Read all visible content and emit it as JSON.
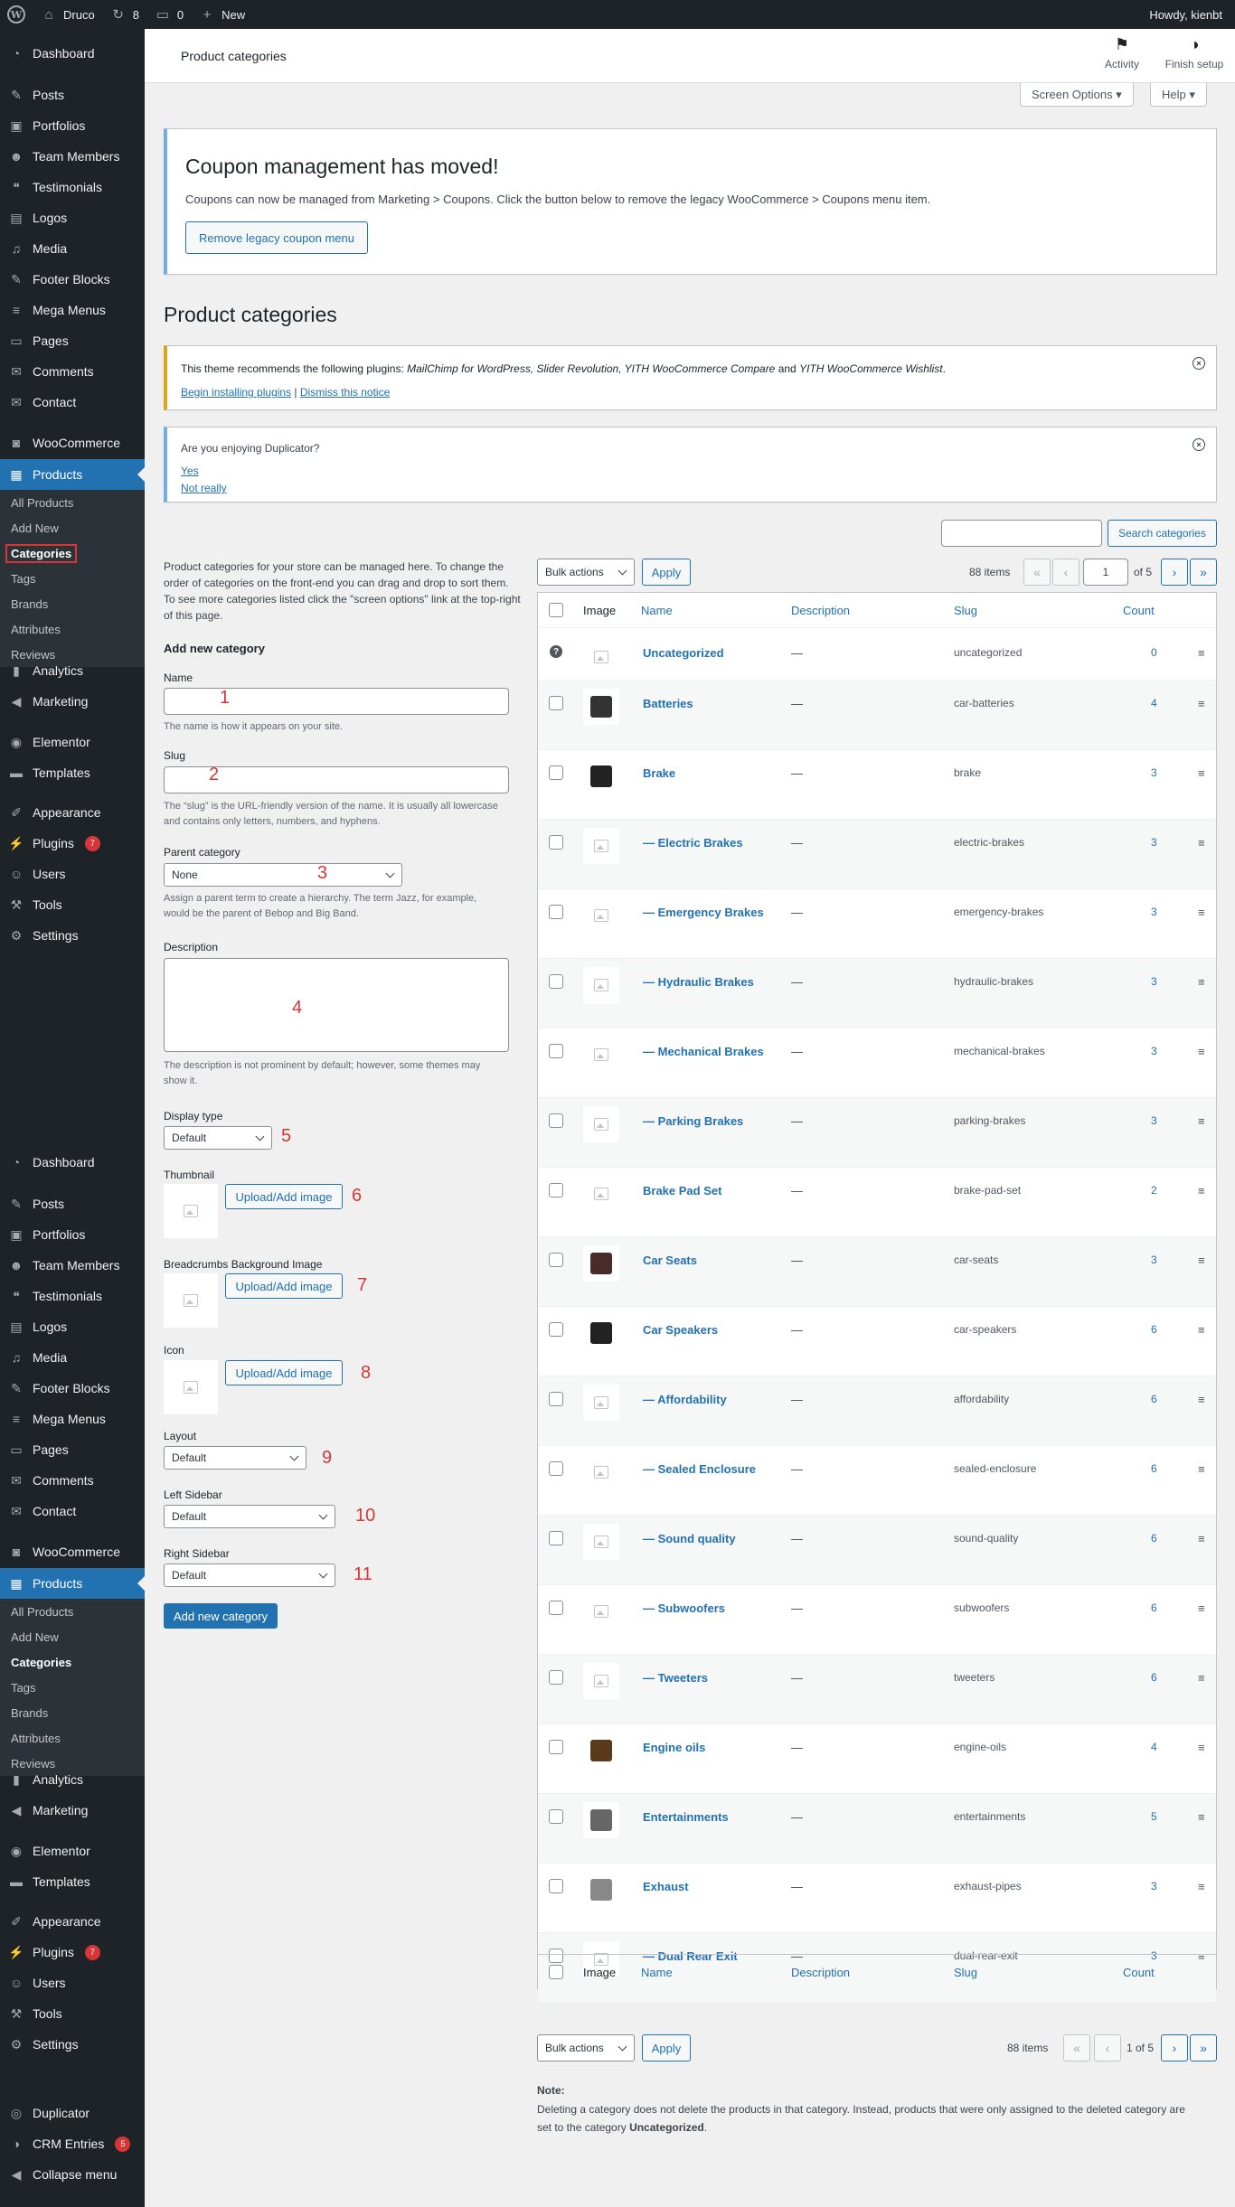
{
  "adminbar": {
    "site_name": "Druco",
    "updates_count": "8",
    "comments_count": "0",
    "new_label": "New",
    "howdy": "Howdy, kienbt"
  },
  "sidebar_top": [
    {
      "label": "Dashboard",
      "icon": "dashboard-icon",
      "glyph": "◔"
    },
    {
      "label": "Posts",
      "icon": "pin-icon",
      "glyph": "✎"
    },
    {
      "label": "Portfolios",
      "icon": "portfolio-icon",
      "glyph": "▣"
    },
    {
      "label": "Team Members",
      "icon": "people-icon",
      "glyph": "☻"
    },
    {
      "label": "Testimonials",
      "icon": "testimonial-icon",
      "glyph": "❝"
    },
    {
      "label": "Logos",
      "icon": "logos-icon",
      "glyph": "▤"
    },
    {
      "label": "Media",
      "icon": "media-icon",
      "glyph": "♫"
    },
    {
      "label": "Footer Blocks",
      "icon": "pin-icon",
      "glyph": "✎"
    },
    {
      "label": "Mega Menus",
      "icon": "menu-icon",
      "glyph": "≡"
    },
    {
      "label": "Pages",
      "icon": "page-icon",
      "glyph": "▭"
    },
    {
      "label": "Comments",
      "icon": "comment-icon",
      "glyph": "✉"
    },
    {
      "label": "Contact",
      "icon": "mail-icon",
      "glyph": "✉"
    },
    {
      "label": "WooCommerce",
      "icon": "woo-icon",
      "glyph": "◙"
    },
    {
      "label": "Products",
      "icon": "products-icon",
      "glyph": "▦"
    }
  ],
  "submenu": [
    "All Products",
    "Add New",
    "Categories",
    "Tags",
    "Brands",
    "Attributes",
    "Reviews"
  ],
  "sidebar_mid": [
    {
      "label": "Analytics",
      "icon": "chart-icon",
      "glyph": "▮"
    },
    {
      "label": "Marketing",
      "icon": "megaphone-icon",
      "glyph": "◀"
    },
    {
      "label": "Elementor",
      "icon": "elementor-icon",
      "glyph": "◉"
    },
    {
      "label": "Templates",
      "icon": "folder-icon",
      "glyph": "▬"
    },
    {
      "label": "Appearance",
      "icon": "brush-icon",
      "glyph": "✐"
    },
    {
      "label": "Plugins",
      "icon": "plugin-icon",
      "glyph": "⚡",
      "badge": "7"
    },
    {
      "label": "Users",
      "icon": "user-icon",
      "glyph": "☺"
    },
    {
      "label": "Tools",
      "icon": "wrench-icon",
      "glyph": "⚒"
    },
    {
      "label": "Settings",
      "icon": "settings-icon",
      "glyph": "⚙"
    }
  ],
  "sidebar_tail": [
    {
      "label": "Duplicator",
      "icon": "duplicator-icon",
      "glyph": "◎"
    },
    {
      "label": "CRM Entries",
      "icon": "crm-icon",
      "glyph": "◑",
      "badge": "5"
    },
    {
      "label": "Collapse menu",
      "icon": "collapse-icon",
      "glyph": "◀"
    }
  ],
  "header": {
    "title": "Product categories",
    "activity": "Activity",
    "finish_setup": "Finish setup",
    "screen_options": "Screen Options ▾",
    "help": "Help ▾"
  },
  "coupon_notice": {
    "title": "Coupon management has moved!",
    "text": "Coupons can now be managed from Marketing > Coupons. Click the button below to remove the legacy WooCommerce > Coupons menu item.",
    "button": "Remove legacy coupon menu"
  },
  "page_title": "Product categories",
  "plugin_notice": {
    "text_start": "This theme recommends the following plugins: ",
    "plugins": "MailChimp for WordPress, Slider Revolution, YITH WooCommerce Compare",
    "and": " and ",
    "last": "YITH WooCommerce Wishlist",
    "dot": ".",
    "install": "Begin installing plugins",
    "sep": " | ",
    "dismiss": "Dismiss this notice"
  },
  "duplicator_notice": {
    "question": "Are you enjoying Duplicator?",
    "yes": "Yes",
    "no": "Not really"
  },
  "form": {
    "intro": "Product categories for your store can be managed here. To change the order of categories on the front-end you can drag and drop to sort them. To see more categories listed click the \"screen options\" link at the top-right of this page.",
    "heading": "Add new category",
    "name_label": "Name",
    "name_desc": "The name is how it appears on your site.",
    "slug_label": "Slug",
    "slug_desc": "The “slug” is the URL-friendly version of the name. It is usually all lowercase and contains only letters, numbers, and hyphens.",
    "parent_label": "Parent category",
    "parent_value": "None",
    "parent_desc": "Assign a parent term to create a hierarchy. The term Jazz, for example, would be the parent of Bebop and Big Band.",
    "description_label": "Description",
    "description_desc": "The description is not prominent by default; however, some themes may show it.",
    "display_label": "Display type",
    "display_value": "Default",
    "thumbnail_label": "Thumbnail",
    "breadcrumbs_label": "Breadcrumbs Background Image",
    "icon_label": "Icon",
    "upload_label": "Upload/Add image",
    "layout_label": "Layout",
    "layout_value": "Default",
    "left_label": "Left Sidebar",
    "left_value": "Default",
    "right_label": "Right Sidebar",
    "right_value": "Default",
    "submit": "Add new category",
    "annotations": [
      "1",
      "2",
      "3",
      "4",
      "5",
      "6",
      "7",
      "8",
      "9",
      "10",
      "11"
    ]
  },
  "list": {
    "search_button": "Search categories",
    "bulk_actions": "Bulk actions",
    "apply": "Apply",
    "items": "88 items",
    "page_current": "1",
    "page_of": "of 5",
    "page_text_bottom": "1 of 5",
    "columns": [
      "Image",
      "Name",
      "Description",
      "Slug",
      "Count"
    ],
    "rows": [
      {
        "name": "Uncategorized",
        "desc": "—",
        "slug": "uncategorized",
        "count": "0"
      },
      {
        "name": "Batteries",
        "desc": "—",
        "slug": "car-batteries",
        "count": "4"
      },
      {
        "name": "Brake",
        "desc": "—",
        "slug": "brake",
        "count": "3"
      },
      {
        "name": "— Electric Brakes",
        "desc": "—",
        "slug": "electric-brakes",
        "count": "3"
      },
      {
        "name": "— Emergency Brakes",
        "desc": "—",
        "slug": "emergency-brakes",
        "count": "3"
      },
      {
        "name": "— Hydraulic Brakes",
        "desc": "—",
        "slug": "hydraulic-brakes",
        "count": "3"
      },
      {
        "name": "— Mechanical Brakes",
        "desc": "—",
        "slug": "mechanical-brakes",
        "count": "3"
      },
      {
        "name": "— Parking Brakes",
        "desc": "—",
        "slug": "parking-brakes",
        "count": "3"
      },
      {
        "name": "Brake Pad Set",
        "desc": "—",
        "slug": "brake-pad-set",
        "count": "2"
      },
      {
        "name": "Car Seats",
        "desc": "—",
        "slug": "car-seats",
        "count": "3"
      },
      {
        "name": "Car Speakers",
        "desc": "—",
        "slug": "car-speakers",
        "count": "6"
      },
      {
        "name": "— Affordability",
        "desc": "—",
        "slug": "affordability",
        "count": "6"
      },
      {
        "name": "— Sealed Enclosure",
        "desc": "—",
        "slug": "sealed-enclosure",
        "count": "6"
      },
      {
        "name": "— Sound quality",
        "desc": "—",
        "slug": "sound-quality",
        "count": "6"
      },
      {
        "name": "— Subwoofers",
        "desc": "—",
        "slug": "subwoofers",
        "count": "6"
      },
      {
        "name": "— Tweeters",
        "desc": "—",
        "slug": "tweeters",
        "count": "6"
      },
      {
        "name": "Engine oils",
        "desc": "—",
        "slug": "engine-oils",
        "count": "4"
      },
      {
        "name": "Entertainments",
        "desc": "—",
        "slug": "entertainments",
        "count": "5"
      },
      {
        "name": "Exhaust",
        "desc": "—",
        "slug": "exhaust-pipes",
        "count": "3"
      },
      {
        "name": "— Dual Rear Exit",
        "desc": "—",
        "slug": "dual-rear-exit",
        "count": "3"
      }
    ],
    "note_title": "Note:",
    "note_text": "Deleting a category does not delete the products in that category. Instead, products that were only assigned to the deleted category are set to the category ",
    "note_bold": "Uncategorized",
    "note_end": "."
  },
  "colors": {
    "admin_dark": "#1d2327",
    "accent": "#2271b1",
    "annotation_red": "#d63638",
    "warning": "#dba617",
    "info": "#72aee6"
  }
}
